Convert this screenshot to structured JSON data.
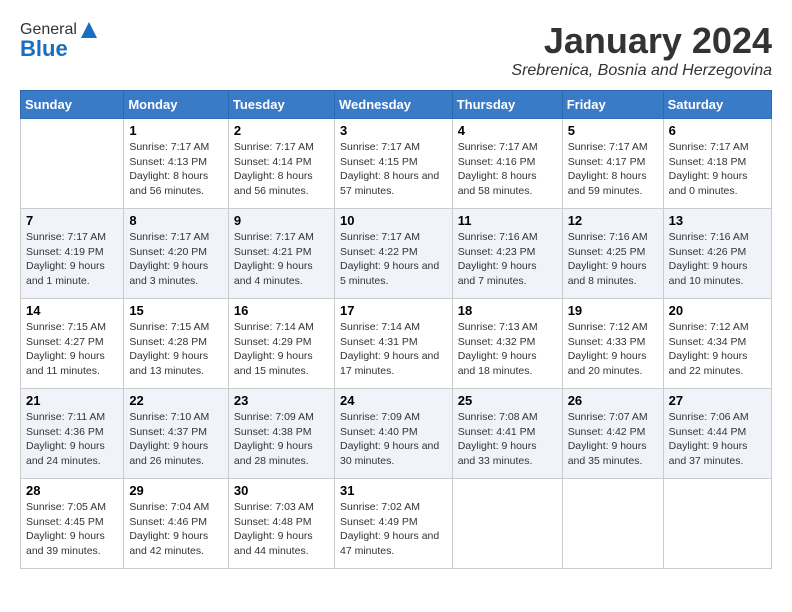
{
  "header": {
    "logo_general": "General",
    "logo_blue": "Blue",
    "month_title": "January 2024",
    "location": "Srebrenica, Bosnia and Herzegovina"
  },
  "days_of_week": [
    "Sunday",
    "Monday",
    "Tuesday",
    "Wednesday",
    "Thursday",
    "Friday",
    "Saturday"
  ],
  "weeks": [
    [
      {
        "day": "",
        "sunrise": "",
        "sunset": "",
        "daylight": ""
      },
      {
        "day": "1",
        "sunrise": "Sunrise: 7:17 AM",
        "sunset": "Sunset: 4:13 PM",
        "daylight": "Daylight: 8 hours and 56 minutes."
      },
      {
        "day": "2",
        "sunrise": "Sunrise: 7:17 AM",
        "sunset": "Sunset: 4:14 PM",
        "daylight": "Daylight: 8 hours and 56 minutes."
      },
      {
        "day": "3",
        "sunrise": "Sunrise: 7:17 AM",
        "sunset": "Sunset: 4:15 PM",
        "daylight": "Daylight: 8 hours and 57 minutes."
      },
      {
        "day": "4",
        "sunrise": "Sunrise: 7:17 AM",
        "sunset": "Sunset: 4:16 PM",
        "daylight": "Daylight: 8 hours and 58 minutes."
      },
      {
        "day": "5",
        "sunrise": "Sunrise: 7:17 AM",
        "sunset": "Sunset: 4:17 PM",
        "daylight": "Daylight: 8 hours and 59 minutes."
      },
      {
        "day": "6",
        "sunrise": "Sunrise: 7:17 AM",
        "sunset": "Sunset: 4:18 PM",
        "daylight": "Daylight: 9 hours and 0 minutes."
      }
    ],
    [
      {
        "day": "7",
        "sunrise": "Sunrise: 7:17 AM",
        "sunset": "Sunset: 4:19 PM",
        "daylight": "Daylight: 9 hours and 1 minute."
      },
      {
        "day": "8",
        "sunrise": "Sunrise: 7:17 AM",
        "sunset": "Sunset: 4:20 PM",
        "daylight": "Daylight: 9 hours and 3 minutes."
      },
      {
        "day": "9",
        "sunrise": "Sunrise: 7:17 AM",
        "sunset": "Sunset: 4:21 PM",
        "daylight": "Daylight: 9 hours and 4 minutes."
      },
      {
        "day": "10",
        "sunrise": "Sunrise: 7:17 AM",
        "sunset": "Sunset: 4:22 PM",
        "daylight": "Daylight: 9 hours and 5 minutes."
      },
      {
        "day": "11",
        "sunrise": "Sunrise: 7:16 AM",
        "sunset": "Sunset: 4:23 PM",
        "daylight": "Daylight: 9 hours and 7 minutes."
      },
      {
        "day": "12",
        "sunrise": "Sunrise: 7:16 AM",
        "sunset": "Sunset: 4:25 PM",
        "daylight": "Daylight: 9 hours and 8 minutes."
      },
      {
        "day": "13",
        "sunrise": "Sunrise: 7:16 AM",
        "sunset": "Sunset: 4:26 PM",
        "daylight": "Daylight: 9 hours and 10 minutes."
      }
    ],
    [
      {
        "day": "14",
        "sunrise": "Sunrise: 7:15 AM",
        "sunset": "Sunset: 4:27 PM",
        "daylight": "Daylight: 9 hours and 11 minutes."
      },
      {
        "day": "15",
        "sunrise": "Sunrise: 7:15 AM",
        "sunset": "Sunset: 4:28 PM",
        "daylight": "Daylight: 9 hours and 13 minutes."
      },
      {
        "day": "16",
        "sunrise": "Sunrise: 7:14 AM",
        "sunset": "Sunset: 4:29 PM",
        "daylight": "Daylight: 9 hours and 15 minutes."
      },
      {
        "day": "17",
        "sunrise": "Sunrise: 7:14 AM",
        "sunset": "Sunset: 4:31 PM",
        "daylight": "Daylight: 9 hours and 17 minutes."
      },
      {
        "day": "18",
        "sunrise": "Sunrise: 7:13 AM",
        "sunset": "Sunset: 4:32 PM",
        "daylight": "Daylight: 9 hours and 18 minutes."
      },
      {
        "day": "19",
        "sunrise": "Sunrise: 7:12 AM",
        "sunset": "Sunset: 4:33 PM",
        "daylight": "Daylight: 9 hours and 20 minutes."
      },
      {
        "day": "20",
        "sunrise": "Sunrise: 7:12 AM",
        "sunset": "Sunset: 4:34 PM",
        "daylight": "Daylight: 9 hours and 22 minutes."
      }
    ],
    [
      {
        "day": "21",
        "sunrise": "Sunrise: 7:11 AM",
        "sunset": "Sunset: 4:36 PM",
        "daylight": "Daylight: 9 hours and 24 minutes."
      },
      {
        "day": "22",
        "sunrise": "Sunrise: 7:10 AM",
        "sunset": "Sunset: 4:37 PM",
        "daylight": "Daylight: 9 hours and 26 minutes."
      },
      {
        "day": "23",
        "sunrise": "Sunrise: 7:09 AM",
        "sunset": "Sunset: 4:38 PM",
        "daylight": "Daylight: 9 hours and 28 minutes."
      },
      {
        "day": "24",
        "sunrise": "Sunrise: 7:09 AM",
        "sunset": "Sunset: 4:40 PM",
        "daylight": "Daylight: 9 hours and 30 minutes."
      },
      {
        "day": "25",
        "sunrise": "Sunrise: 7:08 AM",
        "sunset": "Sunset: 4:41 PM",
        "daylight": "Daylight: 9 hours and 33 minutes."
      },
      {
        "day": "26",
        "sunrise": "Sunrise: 7:07 AM",
        "sunset": "Sunset: 4:42 PM",
        "daylight": "Daylight: 9 hours and 35 minutes."
      },
      {
        "day": "27",
        "sunrise": "Sunrise: 7:06 AM",
        "sunset": "Sunset: 4:44 PM",
        "daylight": "Daylight: 9 hours and 37 minutes."
      }
    ],
    [
      {
        "day": "28",
        "sunrise": "Sunrise: 7:05 AM",
        "sunset": "Sunset: 4:45 PM",
        "daylight": "Daylight: 9 hours and 39 minutes."
      },
      {
        "day": "29",
        "sunrise": "Sunrise: 7:04 AM",
        "sunset": "Sunset: 4:46 PM",
        "daylight": "Daylight: 9 hours and 42 minutes."
      },
      {
        "day": "30",
        "sunrise": "Sunrise: 7:03 AM",
        "sunset": "Sunset: 4:48 PM",
        "daylight": "Daylight: 9 hours and 44 minutes."
      },
      {
        "day": "31",
        "sunrise": "Sunrise: 7:02 AM",
        "sunset": "Sunset: 4:49 PM",
        "daylight": "Daylight: 9 hours and 47 minutes."
      },
      {
        "day": "",
        "sunrise": "",
        "sunset": "",
        "daylight": ""
      },
      {
        "day": "",
        "sunrise": "",
        "sunset": "",
        "daylight": ""
      },
      {
        "day": "",
        "sunrise": "",
        "sunset": "",
        "daylight": ""
      }
    ]
  ]
}
